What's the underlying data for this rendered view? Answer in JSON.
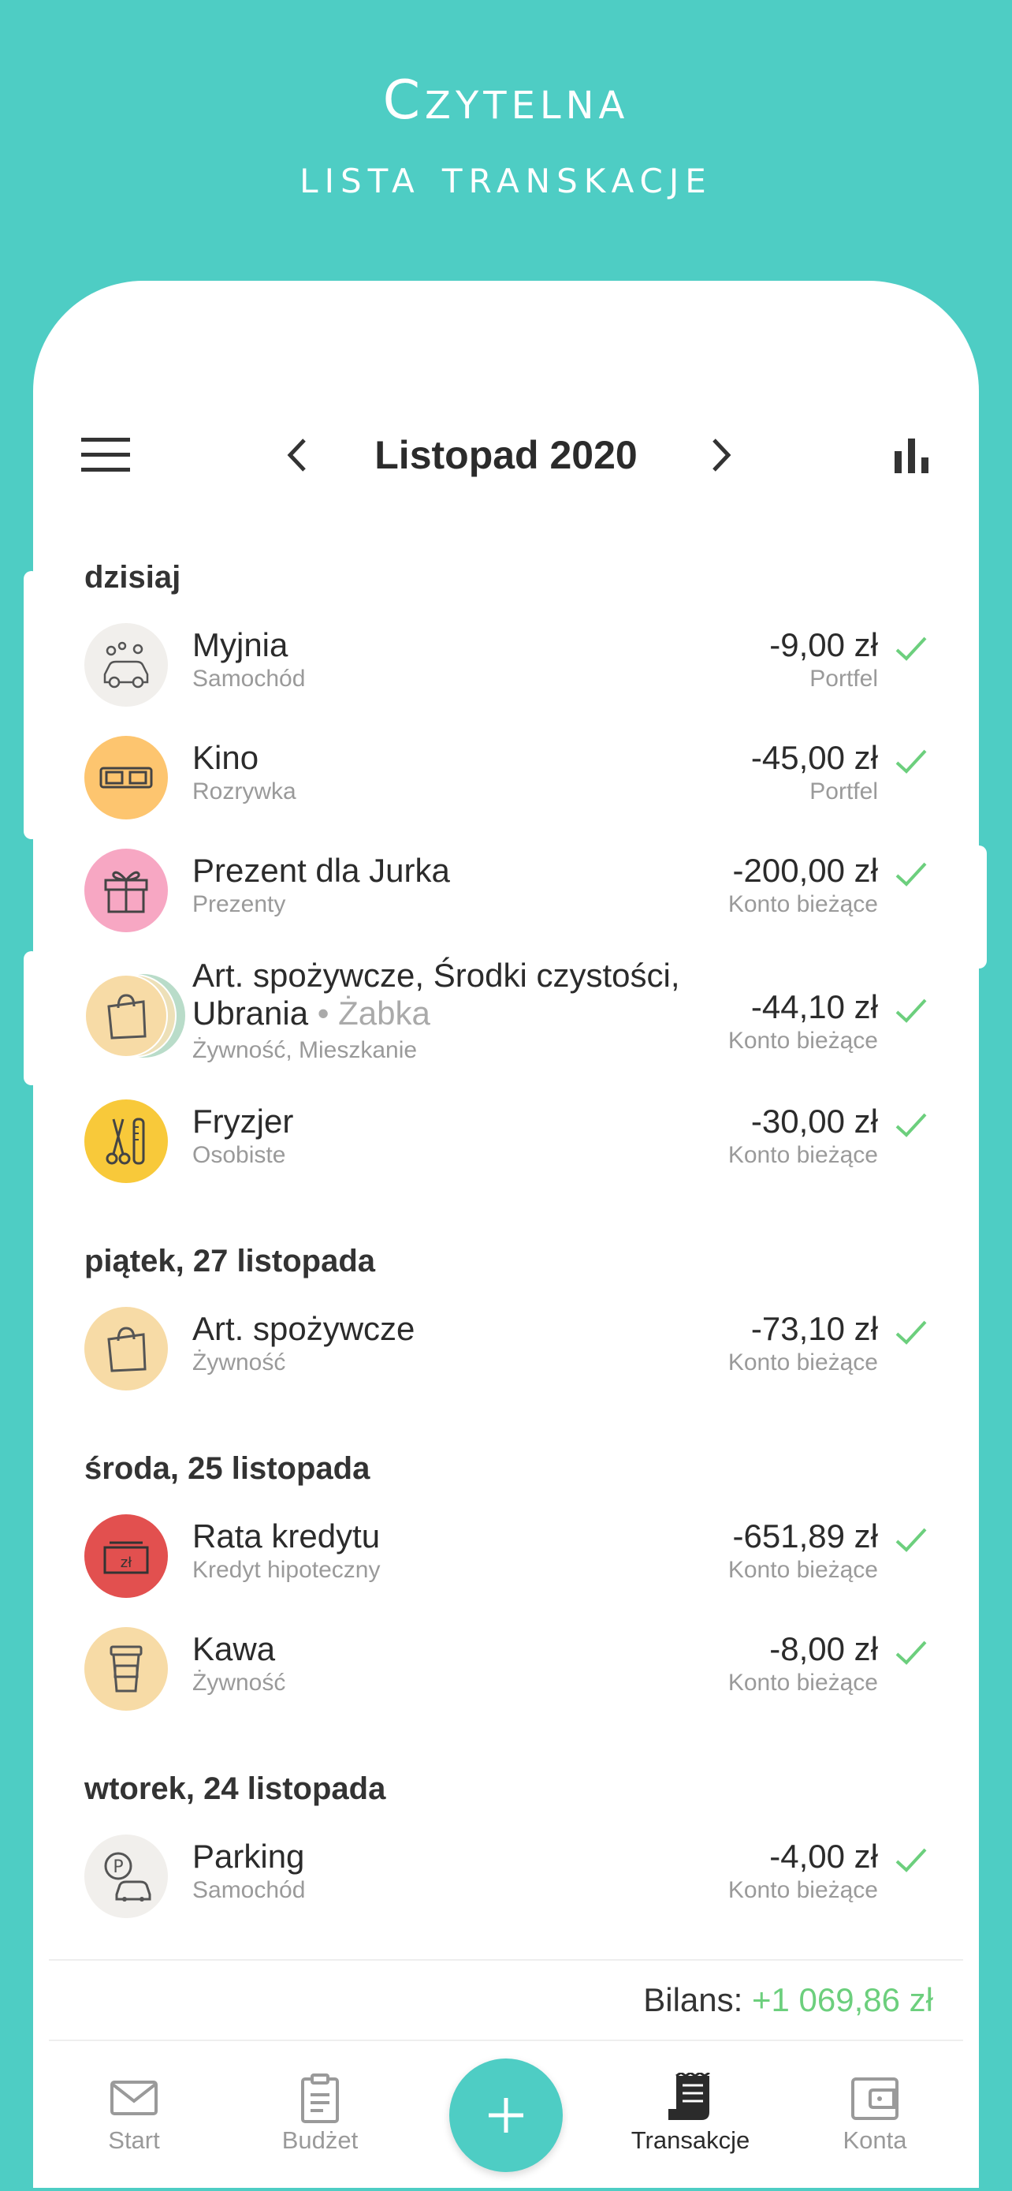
{
  "hero": {
    "line1": "Czytelna",
    "line2": "lista transkacje"
  },
  "header": {
    "month": "Listopad 2020"
  },
  "colors": {
    "accent": "#4ecdc4",
    "positive": "#6ccf7d"
  },
  "days": [
    {
      "label": "dzisiaj",
      "transactions": [
        {
          "name": "Myjnia",
          "category": "Samochód",
          "amount": "-9,00 zł",
          "account": "Portfel",
          "icon": "car-wash-icon",
          "color": "#f1efec"
        },
        {
          "name": "Kino",
          "category": "Rozrywka",
          "amount": "-45,00 zł",
          "account": "Portfel",
          "icon": "3d-glasses-icon",
          "color": "#fdc56f"
        },
        {
          "name": "Prezent dla Jurka",
          "category": "Prezenty",
          "amount": "-200,00 zł",
          "account": "Konto bieżące",
          "icon": "gift-icon",
          "color": "#f7a7c3"
        },
        {
          "name": "Art. spożywcze, Środki czystości,",
          "name2": "Ubrania",
          "store": "• Żabka",
          "category": "Żywność, Mieszkanie",
          "amount": "-44,10 zł",
          "account": "Konto bieżące",
          "icon": "shopping-bag-icon",
          "color": "#f7dba6"
        },
        {
          "name": "Fryzjer",
          "category": "Osobiste",
          "amount": "-30,00 zł",
          "account": "Konto bieżące",
          "icon": "scissors-comb-icon",
          "color": "#f8c93a"
        }
      ]
    },
    {
      "label": "piątek, 27 listopada",
      "transactions": [
        {
          "name": "Art. spożywcze",
          "category": "Żywność",
          "amount": "-73,10 zł",
          "account": "Konto bieżące",
          "icon": "shopping-bag-icon",
          "color": "#f7dba6"
        }
      ]
    },
    {
      "label": "środa, 25 listopada",
      "transactions": [
        {
          "name": "Rata kredytu",
          "category": "Kredyt hipoteczny",
          "amount": "-651,89 zł",
          "account": "Konto bieżące",
          "icon": "banknote-icon",
          "color": "#e2504f"
        },
        {
          "name": "Kawa",
          "category": "Żywność",
          "amount": "-8,00 zł",
          "account": "Konto bieżące",
          "icon": "coffee-cup-icon",
          "color": "#f7dba6"
        }
      ]
    },
    {
      "label": "wtorek, 24 listopada",
      "transactions": [
        {
          "name": "Parking",
          "category": "Samochód",
          "amount": "-4,00 zł",
          "account": "Konto bieżące",
          "icon": "parking-car-icon",
          "color": "#f1efec"
        }
      ]
    }
  ],
  "balance": {
    "label": "Bilans:",
    "value": "+1 069,86 zł"
  },
  "nav": {
    "start": "Start",
    "budget": "Budżet",
    "transactions": "Transakcje",
    "accounts": "Konta"
  }
}
